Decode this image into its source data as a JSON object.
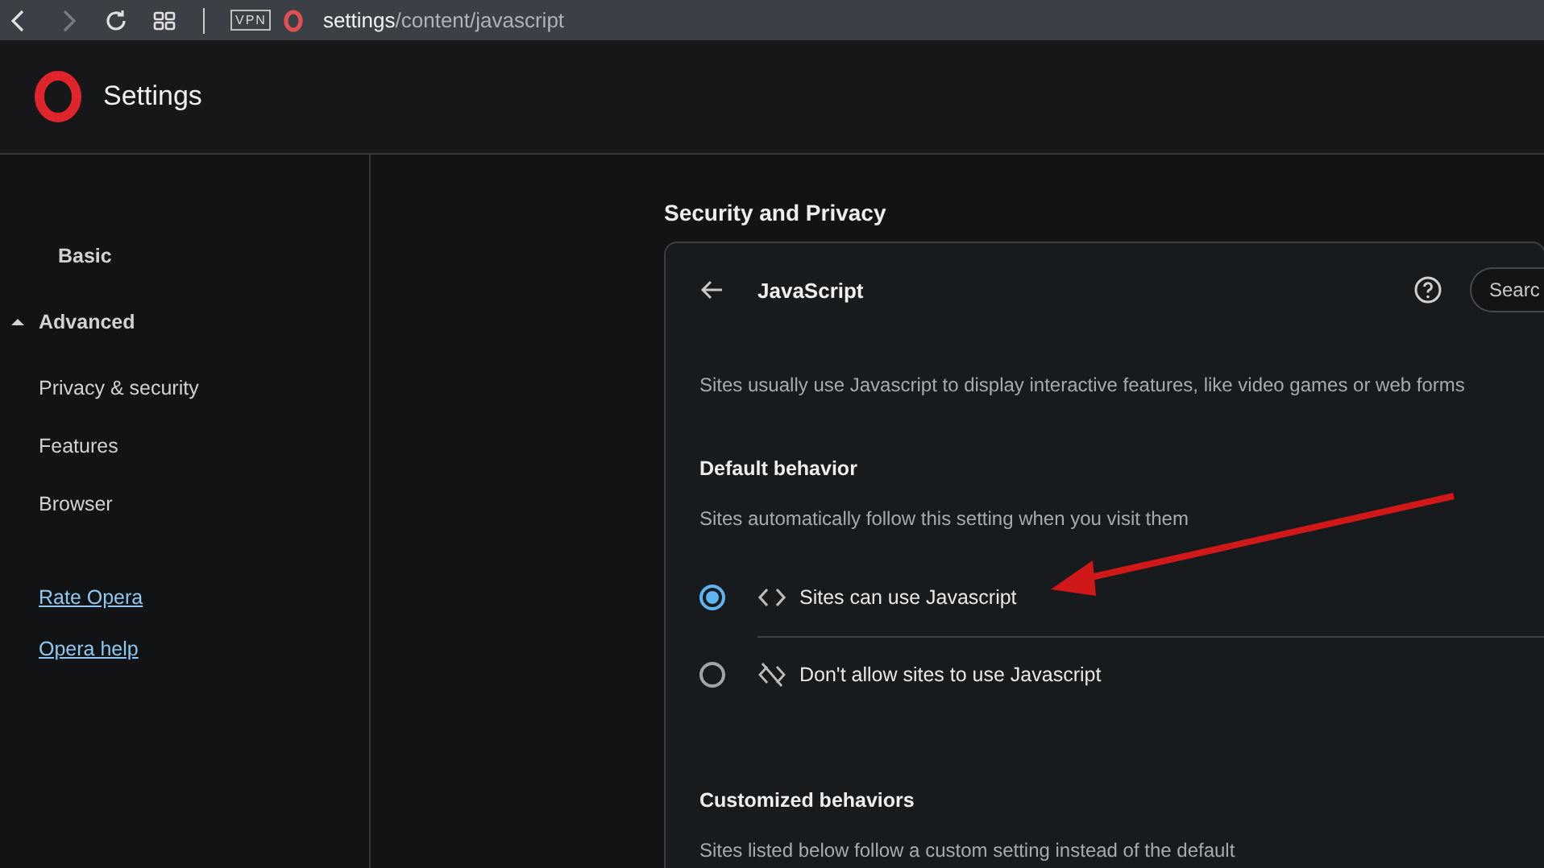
{
  "browser_bar": {
    "address_host": "settings",
    "address_path": "/content/javascript",
    "vpn_badge": "VPN"
  },
  "header": {
    "title": "Settings"
  },
  "sidebar": {
    "items": [
      {
        "label": "Basic",
        "kind": "section",
        "expanded": false
      },
      {
        "label": "Advanced",
        "kind": "section",
        "expanded": true
      },
      {
        "label": "Privacy & security",
        "kind": "item"
      },
      {
        "label": "Features",
        "kind": "item"
      },
      {
        "label": "Browser",
        "kind": "item"
      }
    ],
    "links": [
      "Rate Opera",
      "Opera help"
    ]
  },
  "main": {
    "section_title": "Security and Privacy",
    "card": {
      "title": "JavaScript",
      "search": {
        "placeholder": "Searc"
      },
      "description": "Sites usually use Javascript to display interactive features, like video games or web forms",
      "default_behavior": {
        "heading": "Default behavior",
        "subtitle": "Sites automatically follow this setting when you visit them",
        "options": [
          {
            "label": "Sites can use Javascript",
            "selected": true
          },
          {
            "label": "Don't allow sites to use Javascript",
            "selected": false
          }
        ]
      },
      "customized": {
        "heading": "Customized behaviors",
        "subtitle": "Sites listed below follow a custom setting instead of the default"
      }
    }
  }
}
